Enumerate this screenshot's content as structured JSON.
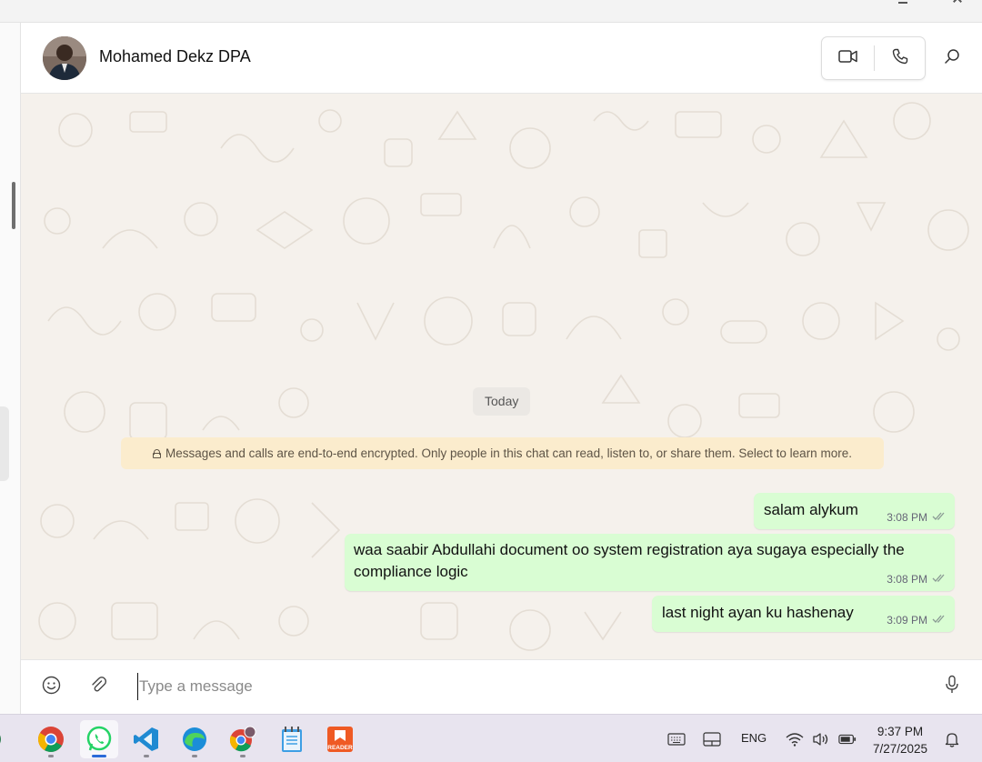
{
  "chat": {
    "contact_name": "Mohamed Dekz DPA",
    "day_label": "Today",
    "encryption_notice": "Messages and calls are end-to-end encrypted. Only people in this chat can read, listen to, or share them. Select to learn more.",
    "messages": [
      {
        "text": "salam alykum",
        "time": "3:08 PM",
        "status": "read-ticks"
      },
      {
        "text": "waa saabir Abdullahi document oo system registration aya sugaya especially the compliance logic",
        "time": "3:08 PM",
        "status": "read-ticks"
      },
      {
        "text": "last night ayan ku hashenay",
        "time": "3:09 PM",
        "status": "read-ticks"
      }
    ]
  },
  "compose": {
    "placeholder": "Type a message",
    "value": ""
  },
  "header_icons": [
    "video-call-icon",
    "voice-call-icon",
    "search-icon"
  ],
  "taskbar": {
    "apps": [
      "chrome-icon",
      "whatsapp-icon",
      "vscode-icon",
      "edge-icon",
      "chrome-profile-icon",
      "notepad-icon",
      "reader-icon"
    ],
    "active_app": "whatsapp-icon",
    "reader_label": "READER",
    "language": "ENG",
    "time": "9:37 PM",
    "date": "7/27/2025"
  },
  "colors": {
    "outgoing_bubble": "#d9fdd3",
    "chat_background": "#f5f1ec",
    "notice_background": "#fbeccd",
    "taskbar": "#e8e4ef",
    "active_indicator": "#2a6ad8"
  }
}
